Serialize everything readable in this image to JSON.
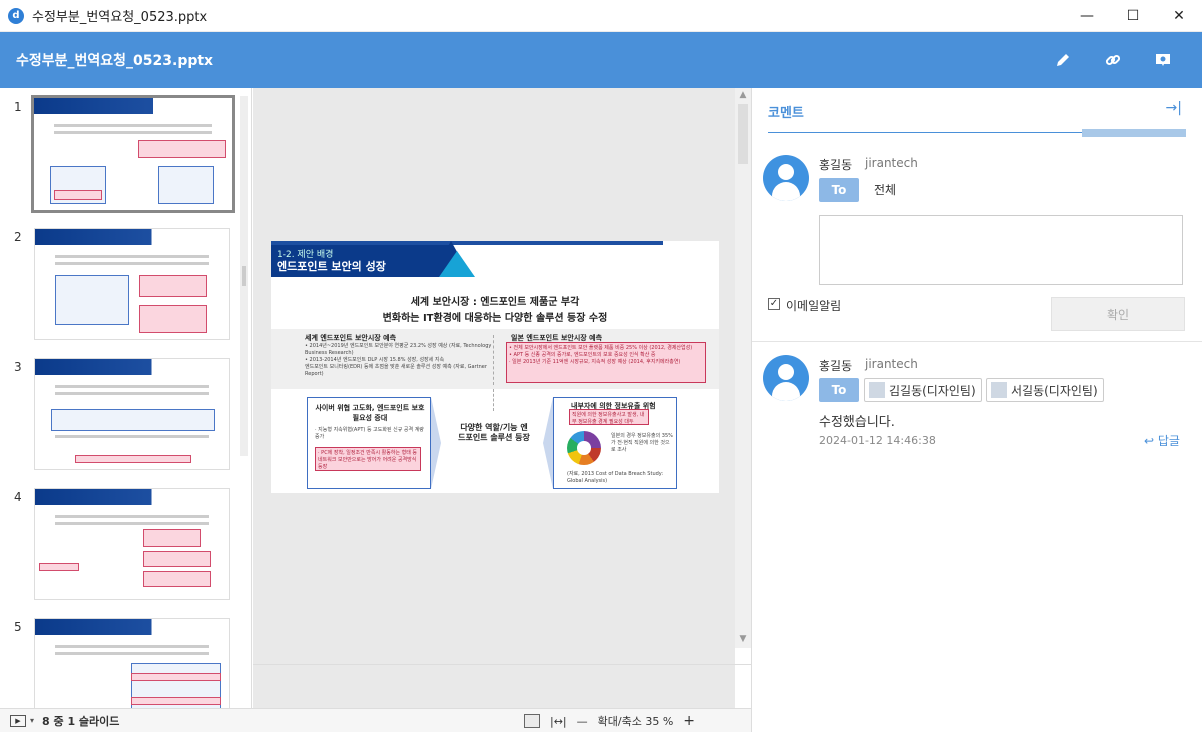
{
  "window": {
    "title": "수정부분_번역요청_0523.pptx",
    "app_icon_letter": "d",
    "minimize": "—",
    "maximize": "☐",
    "close": "✕"
  },
  "header": {
    "title": "수정부분_번역요청_0523.pptx"
  },
  "thumbnails": {
    "numbers": [
      "1",
      "2",
      "3",
      "4",
      "5"
    ]
  },
  "slide": {
    "tag": "1-2. 제안 배경",
    "heading": "엔드포인트 보안의 성장",
    "sub1": "세계 보안시장 : 엔드포인트 제품군 부각",
    "sub2": "변화하는 IT환경에 대응하는 다양한 솔루션 등장 수정",
    "left_col_title": "세계 엔드포인트 보안시장 예측",
    "left_col_text": "• 2014년~2019년 엔드포인트 보안분야 연평균 23.2% 성장 예상 (자료, Technology Business Research)\n• 2013-2014년 엔드포인트 DLP 시장 15.8% 성장, 성장세 지속\n엔드포인트 모니터링(EDR) 등에 초점을 맞춘 새로운 솔루션 성장 예측 (자료, Gartner Report)",
    "right_col_title": "일본 엔드포인트 보안시장 예측",
    "right_col_text": "• 전체 보안시장에서 엔드포인트 보안 플랫폼 제품 비중 25% 이상 (2012, 경제산업성)\n• APT 등 신종 공격의 증가로, 엔드포인트의 보호 중요성 인식 확산 중\n· 일본 2013년 기준 11억엔 시장규모, 지속적 성장 예상 (2014, 후지키메라총연)",
    "left_box_title": "사이버 위협 고도화, 엔드포인트 보호 필요성 증대",
    "left_box_text": "· 지능형 지속위협(APT) 등 고도화된 신규 공격 계량 증가",
    "left_box_pink": "· PC에 장착, 일정조건 만족시 활동하는 형태 등 네트워크 보안만으로는 방어가 어려운 공격방식 등장",
    "center_text": "다양한 역할/기능 엔드포인트 솔루션 등장",
    "right_box_title": "내부자에 의한 정보유출 위험",
    "right_box_pink": "직원에 의한 정보유출사고 발생, 내부 정보유출 경계 필요성 대두",
    "right_box_text": "일본의 경우 정보유출의 35%가 전·현직 직원에 의한 것으로 조사",
    "right_box_source": "(자료, 2013 Cost of Data Breach Study: Global Analysis)"
  },
  "status": {
    "slide_count": "8 중 1 슬라이드",
    "zoom_label": "확대/축소 35 %",
    "zoom_minus": "—",
    "zoom_plus": "+",
    "fit_width": "|↔|"
  },
  "panel": {
    "title": "코멘트",
    "close_icon": "→|",
    "composer": {
      "user": "홍길동",
      "company": "jirantech",
      "to_label": "To",
      "to_target": "전체",
      "textarea_value": "",
      "email_checkbox_label": "이메일알림",
      "email_checked": "✓",
      "confirm_label": "확인"
    },
    "comment": {
      "user": "홍길동",
      "company": "jirantech",
      "to_label": "To",
      "mentions": [
        "김길동(디자인팀)",
        "서길동(디자인팀)"
      ],
      "text": "수정했습니다.",
      "date": "2024-01-12 14:46:38",
      "reply_label": "답글"
    }
  },
  "colors": {
    "accent": "#4a90d9",
    "navy": "#0b3a8a",
    "pink": "#fbd3dd",
    "pink_border": "#c8385a"
  }
}
